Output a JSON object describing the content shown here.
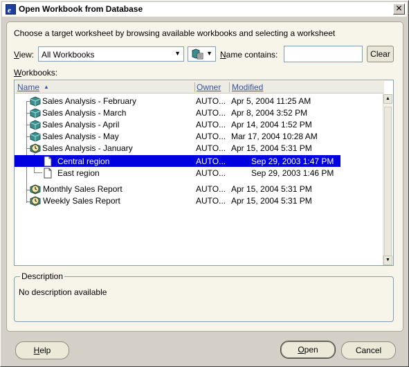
{
  "window": {
    "title": "Open Workbook from Database",
    "close_glyph": "✕"
  },
  "instructions": "Choose a target worksheet by browsing available workbooks and selecting a worksheet",
  "filter": {
    "view_label": "View:",
    "view_value": "All Workbooks",
    "name_label": "Name contains:",
    "name_value": "",
    "clear_label": "Clear"
  },
  "workbooks_label": "Workbooks:",
  "tree": {
    "columns": {
      "name": "Name",
      "owner": "Owner",
      "modified": "Modified"
    },
    "rows": [
      {
        "name": "Sales Analysis - February",
        "owner": "AUTO...",
        "modified": "Apr 5, 2004 11:25 AM",
        "icon": "workbook-icon"
      },
      {
        "name": "Sales Analysis - March",
        "owner": "AUTO...",
        "modified": "Apr 8, 2004 3:52 PM",
        "icon": "workbook-icon"
      },
      {
        "name": "Sales Analysis - April",
        "owner": "AUTO...",
        "modified": "Apr 14, 2004 1:52 PM",
        "icon": "workbook-icon"
      },
      {
        "name": "Sales Analysis - May",
        "owner": "AUTO...",
        "modified": "Mar 17, 2004 10:28 AM",
        "icon": "workbook-icon"
      },
      {
        "name": "Sales Analysis - January",
        "owner": "AUTO...",
        "modified": "Apr 15, 2004 5:31 PM",
        "icon": "scheduled-workbook-icon"
      },
      {
        "name": "Central region",
        "owner": "AUTO...",
        "modified": "Sep 29, 2003 1:47 PM",
        "icon": "worksheet-icon"
      },
      {
        "name": "East region",
        "owner": "AUTO...",
        "modified": "Sep 29, 2003 1:46 PM",
        "icon": "worksheet-icon"
      },
      {
        "name": "Monthly Sales Report",
        "owner": "AUTO...",
        "modified": "Apr 15, 2004 5:31 PM",
        "icon": "scheduled-workbook-icon"
      },
      {
        "name": "Weekly Sales Report",
        "owner": "AUTO...",
        "modified": "Apr 15, 2004 5:31 PM",
        "icon": "scheduled-workbook-icon"
      }
    ]
  },
  "description": {
    "legend": "Description",
    "text": "No description available"
  },
  "buttons": {
    "help": "Help",
    "open": "Open",
    "cancel": "Cancel"
  },
  "colors": {
    "selection": "#0000e0",
    "header_text": "#3a52a3",
    "panel": "#f7f5ea"
  }
}
